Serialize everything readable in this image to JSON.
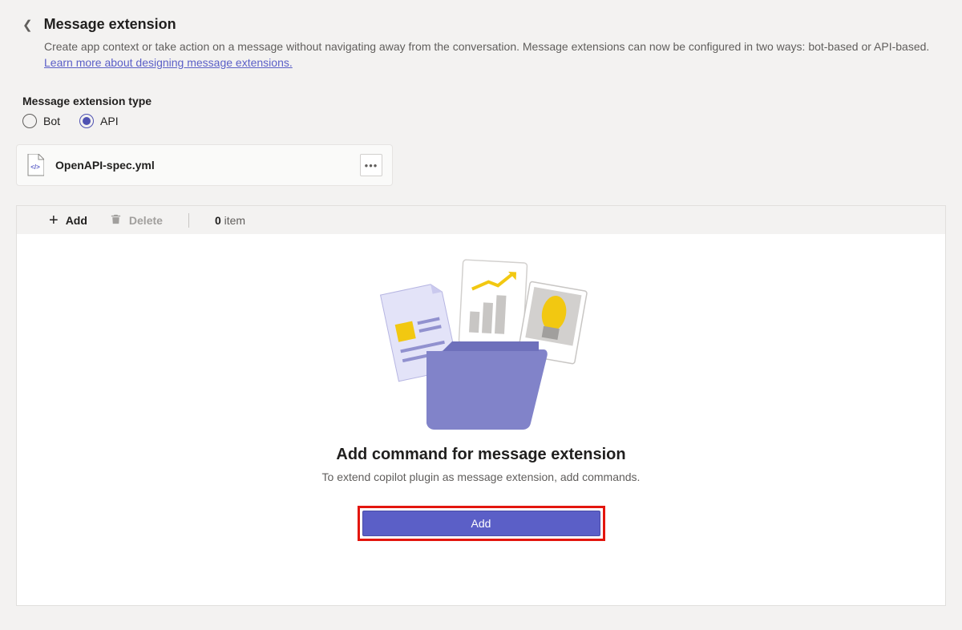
{
  "header": {
    "title": "Message extension",
    "description_prefix": "Create app context or take action on a message without navigating away from the conversation. Message extensions can now be configured in two ways: bot-based or API-based. ",
    "link_text": "Learn more about designing message extensions."
  },
  "type_section": {
    "label": "Message extension type",
    "options": {
      "bot": "Bot",
      "api": "API"
    },
    "selected": "api"
  },
  "file": {
    "name": "OpenAPI-spec.yml"
  },
  "toolbar": {
    "add_label": "Add",
    "delete_label": "Delete",
    "item_count_number": "0",
    "item_count_word": "item"
  },
  "empty_state": {
    "title": "Add command for message extension",
    "subtitle": "To extend copilot plugin as message extension, add commands.",
    "button_label": "Add"
  }
}
